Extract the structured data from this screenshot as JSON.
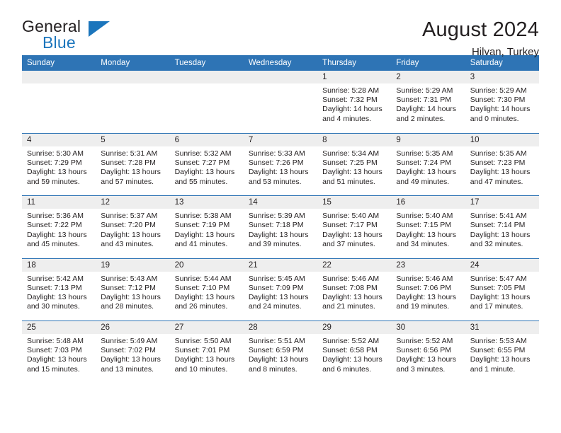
{
  "brand": {
    "word_one": "General",
    "word_two": "Blue",
    "triangle_icon": "triangle-icon",
    "accent_color": "#1b75bc"
  },
  "header": {
    "title": "August 2024",
    "location": "Hilvan, Turkey"
  },
  "theme": {
    "header_blue": "#2e74b5",
    "daynum_gray": "#eeeeee",
    "text": "#231f20"
  },
  "weekday_headers": [
    "Sunday",
    "Monday",
    "Tuesday",
    "Wednesday",
    "Thursday",
    "Friday",
    "Saturday"
  ],
  "labels": {
    "sunrise_prefix": "Sunrise:",
    "sunset_prefix": "Sunset:",
    "daylight_prefix": "Daylight:"
  },
  "weeks": [
    [
      {
        "day": "",
        "empty": true
      },
      {
        "day": "",
        "empty": true
      },
      {
        "day": "",
        "empty": true
      },
      {
        "day": "",
        "empty": true
      },
      {
        "day": "1",
        "sunrise": "Sunrise: 5:28 AM",
        "sunset": "Sunset: 7:32 PM",
        "daylight": "Daylight: 14 hours and 4 minutes."
      },
      {
        "day": "2",
        "sunrise": "Sunrise: 5:29 AM",
        "sunset": "Sunset: 7:31 PM",
        "daylight": "Daylight: 14 hours and 2 minutes."
      },
      {
        "day": "3",
        "sunrise": "Sunrise: 5:29 AM",
        "sunset": "Sunset: 7:30 PM",
        "daylight": "Daylight: 14 hours and 0 minutes."
      }
    ],
    [
      {
        "day": "4",
        "sunrise": "Sunrise: 5:30 AM",
        "sunset": "Sunset: 7:29 PM",
        "daylight": "Daylight: 13 hours and 59 minutes."
      },
      {
        "day": "5",
        "sunrise": "Sunrise: 5:31 AM",
        "sunset": "Sunset: 7:28 PM",
        "daylight": "Daylight: 13 hours and 57 minutes."
      },
      {
        "day": "6",
        "sunrise": "Sunrise: 5:32 AM",
        "sunset": "Sunset: 7:27 PM",
        "daylight": "Daylight: 13 hours and 55 minutes."
      },
      {
        "day": "7",
        "sunrise": "Sunrise: 5:33 AM",
        "sunset": "Sunset: 7:26 PM",
        "daylight": "Daylight: 13 hours and 53 minutes."
      },
      {
        "day": "8",
        "sunrise": "Sunrise: 5:34 AM",
        "sunset": "Sunset: 7:25 PM",
        "daylight": "Daylight: 13 hours and 51 minutes."
      },
      {
        "day": "9",
        "sunrise": "Sunrise: 5:35 AM",
        "sunset": "Sunset: 7:24 PM",
        "daylight": "Daylight: 13 hours and 49 minutes."
      },
      {
        "day": "10",
        "sunrise": "Sunrise: 5:35 AM",
        "sunset": "Sunset: 7:23 PM",
        "daylight": "Daylight: 13 hours and 47 minutes."
      }
    ],
    [
      {
        "day": "11",
        "sunrise": "Sunrise: 5:36 AM",
        "sunset": "Sunset: 7:22 PM",
        "daylight": "Daylight: 13 hours and 45 minutes."
      },
      {
        "day": "12",
        "sunrise": "Sunrise: 5:37 AM",
        "sunset": "Sunset: 7:20 PM",
        "daylight": "Daylight: 13 hours and 43 minutes."
      },
      {
        "day": "13",
        "sunrise": "Sunrise: 5:38 AM",
        "sunset": "Sunset: 7:19 PM",
        "daylight": "Daylight: 13 hours and 41 minutes."
      },
      {
        "day": "14",
        "sunrise": "Sunrise: 5:39 AM",
        "sunset": "Sunset: 7:18 PM",
        "daylight": "Daylight: 13 hours and 39 minutes."
      },
      {
        "day": "15",
        "sunrise": "Sunrise: 5:40 AM",
        "sunset": "Sunset: 7:17 PM",
        "daylight": "Daylight: 13 hours and 37 minutes."
      },
      {
        "day": "16",
        "sunrise": "Sunrise: 5:40 AM",
        "sunset": "Sunset: 7:15 PM",
        "daylight": "Daylight: 13 hours and 34 minutes."
      },
      {
        "day": "17",
        "sunrise": "Sunrise: 5:41 AM",
        "sunset": "Sunset: 7:14 PM",
        "daylight": "Daylight: 13 hours and 32 minutes."
      }
    ],
    [
      {
        "day": "18",
        "sunrise": "Sunrise: 5:42 AM",
        "sunset": "Sunset: 7:13 PM",
        "daylight": "Daylight: 13 hours and 30 minutes."
      },
      {
        "day": "19",
        "sunrise": "Sunrise: 5:43 AM",
        "sunset": "Sunset: 7:12 PM",
        "daylight": "Daylight: 13 hours and 28 minutes."
      },
      {
        "day": "20",
        "sunrise": "Sunrise: 5:44 AM",
        "sunset": "Sunset: 7:10 PM",
        "daylight": "Daylight: 13 hours and 26 minutes."
      },
      {
        "day": "21",
        "sunrise": "Sunrise: 5:45 AM",
        "sunset": "Sunset: 7:09 PM",
        "daylight": "Daylight: 13 hours and 24 minutes."
      },
      {
        "day": "22",
        "sunrise": "Sunrise: 5:46 AM",
        "sunset": "Sunset: 7:08 PM",
        "daylight": "Daylight: 13 hours and 21 minutes."
      },
      {
        "day": "23",
        "sunrise": "Sunrise: 5:46 AM",
        "sunset": "Sunset: 7:06 PM",
        "daylight": "Daylight: 13 hours and 19 minutes."
      },
      {
        "day": "24",
        "sunrise": "Sunrise: 5:47 AM",
        "sunset": "Sunset: 7:05 PM",
        "daylight": "Daylight: 13 hours and 17 minutes."
      }
    ],
    [
      {
        "day": "25",
        "sunrise": "Sunrise: 5:48 AM",
        "sunset": "Sunset: 7:03 PM",
        "daylight": "Daylight: 13 hours and 15 minutes."
      },
      {
        "day": "26",
        "sunrise": "Sunrise: 5:49 AM",
        "sunset": "Sunset: 7:02 PM",
        "daylight": "Daylight: 13 hours and 13 minutes."
      },
      {
        "day": "27",
        "sunrise": "Sunrise: 5:50 AM",
        "sunset": "Sunset: 7:01 PM",
        "daylight": "Daylight: 13 hours and 10 minutes."
      },
      {
        "day": "28",
        "sunrise": "Sunrise: 5:51 AM",
        "sunset": "Sunset: 6:59 PM",
        "daylight": "Daylight: 13 hours and 8 minutes."
      },
      {
        "day": "29",
        "sunrise": "Sunrise: 5:52 AM",
        "sunset": "Sunset: 6:58 PM",
        "daylight": "Daylight: 13 hours and 6 minutes."
      },
      {
        "day": "30",
        "sunrise": "Sunrise: 5:52 AM",
        "sunset": "Sunset: 6:56 PM",
        "daylight": "Daylight: 13 hours and 3 minutes."
      },
      {
        "day": "31",
        "sunrise": "Sunrise: 5:53 AM",
        "sunset": "Sunset: 6:55 PM",
        "daylight": "Daylight: 13 hours and 1 minute."
      }
    ]
  ]
}
